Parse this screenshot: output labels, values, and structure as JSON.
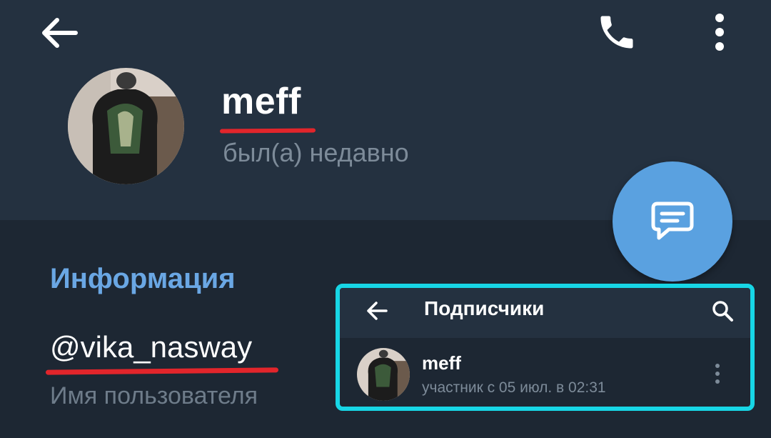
{
  "header": {
    "back_icon": "arrow-left-icon",
    "call_icon": "phone-icon",
    "more_icon": "more-vertical-icon",
    "name": "meff",
    "status": "был(а) недавно",
    "background": "#243140"
  },
  "fab": {
    "icon": "message-icon",
    "color": "#5aa1e0"
  },
  "info": {
    "section_title": "Информация",
    "username": "@vika_nasway",
    "username_label": "Имя пользователя"
  },
  "annotations": {
    "underline_color": "#e2252b",
    "box_color": "#17d6e6"
  },
  "subscribers_panel": {
    "title": "Подписчики",
    "back_icon": "arrow-left-icon",
    "search_icon": "search-icon",
    "member": {
      "name": "meff",
      "subtitle": "участник с 05 июл. в 02:31",
      "more_icon": "more-vertical-icon"
    }
  }
}
